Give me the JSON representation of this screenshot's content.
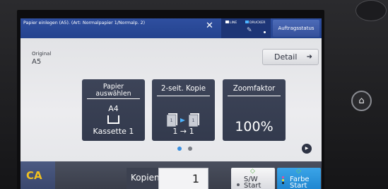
{
  "topbar": {
    "message": "Papier einlegen (A5). (Art: Normalpapier 1/Normalp. 2)",
    "close_icon": "close-icon",
    "line_label": "LINE",
    "drucker_label": "DRUCKER",
    "job_status_label": "Auftragsstatus"
  },
  "main": {
    "original_label": "Original",
    "original_value": "A5",
    "detail_label": "Detail",
    "cards": {
      "paper": {
        "title_line1": "Papier",
        "title_line2": "auswählen",
        "size": "A4",
        "tray": "Kassette 1"
      },
      "duplex": {
        "title": "2-seit. Kopie",
        "mode": "1 → 1"
      },
      "zoom": {
        "title": "Zoomfaktor",
        "value": "100%"
      }
    },
    "page_indicator": {
      "count": 2,
      "active": 1
    }
  },
  "bottombar": {
    "ca_label": "CA",
    "copies_label": "Kopien",
    "copies_value": "1",
    "bw_start_line1": "S/W",
    "bw_start_line2": "Start",
    "color_start_line1": "Farbe",
    "color_start_line2": "Start"
  },
  "colors": {
    "accent_blue": "#2f4fa0",
    "card_bg": "#3d4458",
    "ca_yellow": "#f0c020",
    "color_start": "#2a94dc",
    "start_green": "#5ab04a",
    "page_dot_active": "#3a8fe0"
  }
}
